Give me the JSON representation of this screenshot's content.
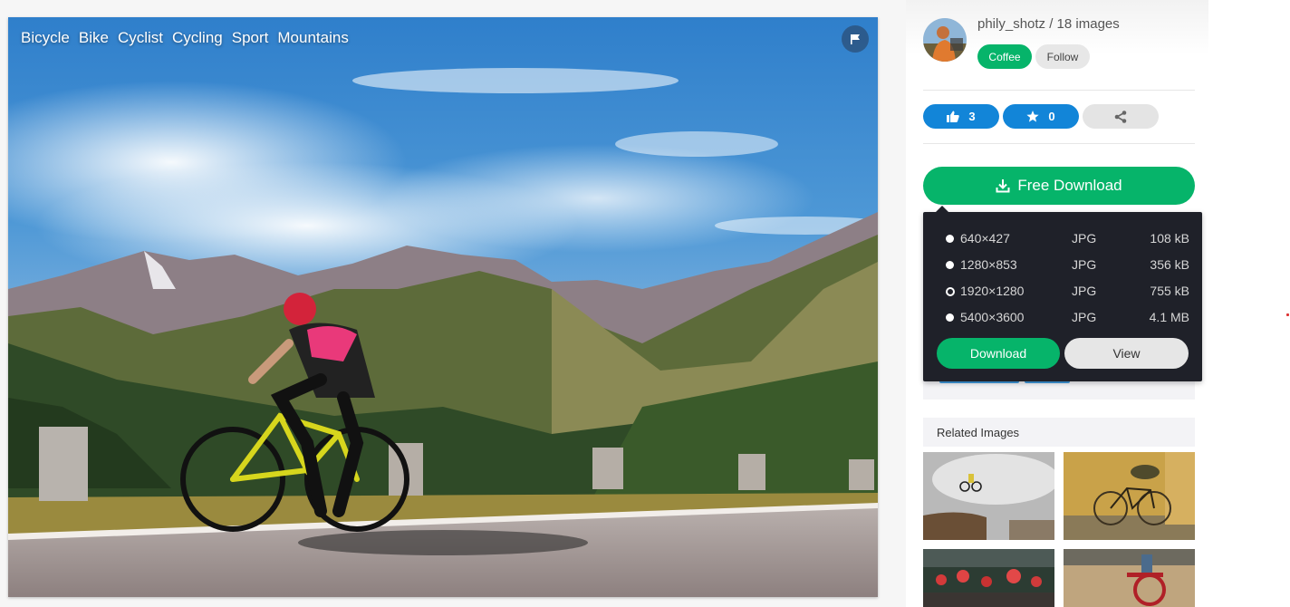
{
  "photo": {
    "tags": [
      "Bicycle",
      "Bike",
      "Cyclist",
      "Cycling",
      "Sport",
      "Mountains"
    ],
    "flag_icon": "flag-icon"
  },
  "author": {
    "name_line": "phily_shotz / 18 images",
    "coffee_label": "Coffee",
    "follow_label": "Follow"
  },
  "actions": {
    "like_count": "3",
    "fav_count": "0",
    "like_icon": "thumbs-up-icon",
    "fav_icon": "star-icon",
    "share_icon": "share-icon"
  },
  "download": {
    "free_label": "Free Download",
    "sizes": [
      {
        "dim": "640×427",
        "format": "JPG",
        "size": "108 kB",
        "selected": false
      },
      {
        "dim": "1280×853",
        "format": "JPG",
        "size": "356 kB",
        "selected": false
      },
      {
        "dim": "1920×1280",
        "format": "JPG",
        "size": "755 kB",
        "selected": true
      },
      {
        "dim": "5400×3600",
        "format": "JPG",
        "size": "4.1 MB",
        "selected": false
      }
    ],
    "download_label": "Download",
    "view_label": "View"
  },
  "related": {
    "heading": "Related Images"
  },
  "colors": {
    "green": "#06b46a",
    "blue": "#1285d8",
    "dropdown_bg": "#1f2129"
  }
}
